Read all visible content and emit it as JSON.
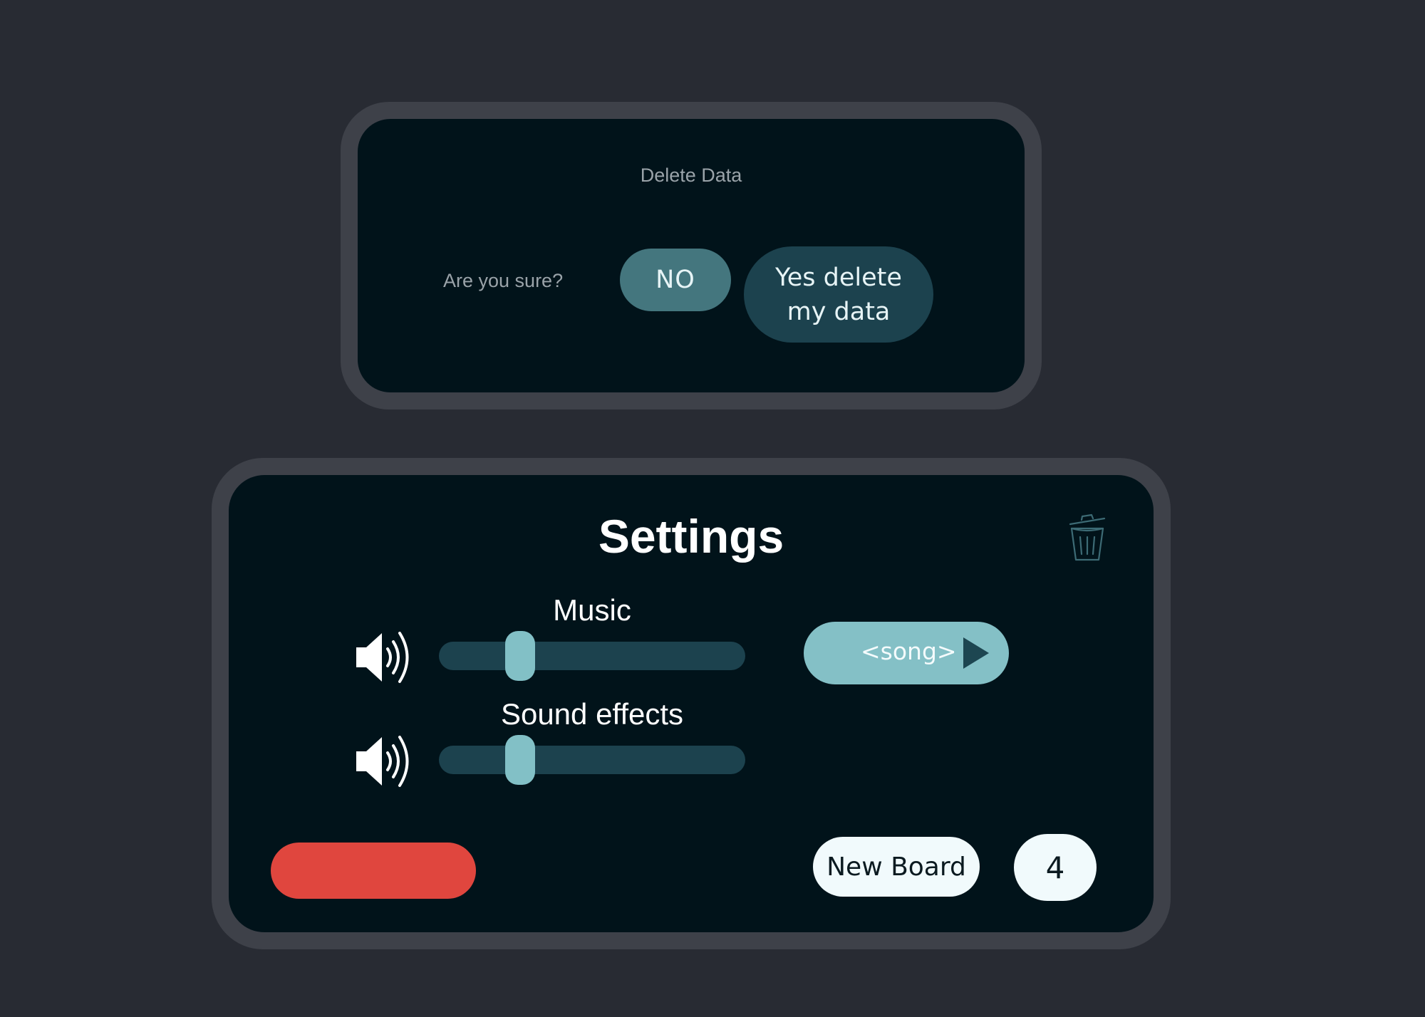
{
  "delete_dialog": {
    "title": "Delete Data",
    "question": "Are you sure?",
    "no_label": "NO",
    "yes_label": "Yes delete my data"
  },
  "settings": {
    "title": "Settings",
    "music": {
      "label": "Music",
      "level": 0.24,
      "icon": "speaker-icon"
    },
    "sound_effects": {
      "label": "Sound effects",
      "level": 0.24,
      "icon": "speaker-icon"
    },
    "song": {
      "label": "<song>",
      "icon": "play-icon"
    },
    "new_board_label": "New Board",
    "board_count": "4",
    "delete_icon": "trash-icon"
  },
  "colors": {
    "background": "#282b33",
    "panel_border": "#3e4149",
    "panel_fill": "#01131a",
    "accent_teal": "#44767e",
    "accent_dark_teal": "#1c424e",
    "accent_light_teal": "#84c0c6",
    "danger_red": "#e0463e",
    "light_button": "#f1fafc"
  }
}
